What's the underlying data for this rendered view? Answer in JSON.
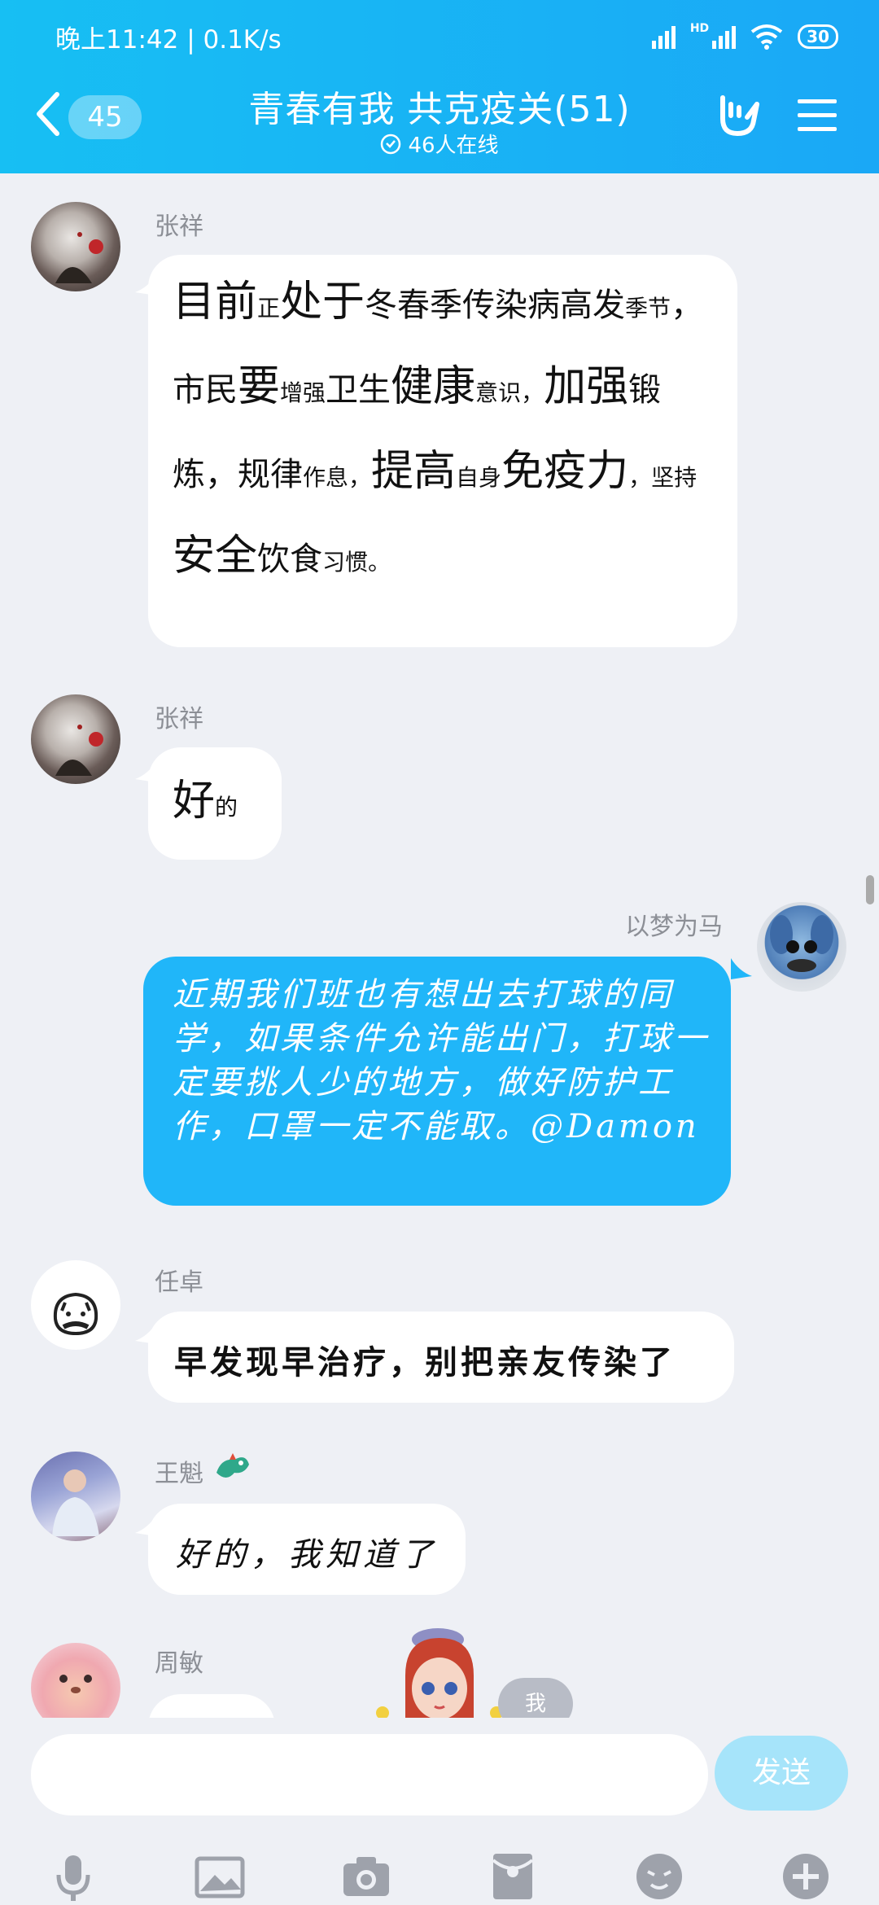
{
  "status": {
    "time_speed": "晚上11:42 | 0.1K/s",
    "network": "HD",
    "battery": "30"
  },
  "header": {
    "unread_count": "45",
    "title": "青春有我 共克疫关(51)",
    "online": "46人在线"
  },
  "messages": [
    {
      "sender": "张祥",
      "side": "left",
      "text_segments": [
        [
          "目前",
          "big"
        ],
        [
          "正",
          "sm"
        ],
        [
          "处于",
          "big"
        ],
        [
          "冬春季传染病高",
          "mid"
        ],
        [
          "发",
          "mid"
        ],
        [
          "季节",
          "sm"
        ],
        [
          "，市民",
          "mid"
        ],
        [
          "要",
          "big"
        ],
        [
          "增强",
          "sm"
        ],
        [
          "卫生",
          "mid"
        ],
        [
          "健康",
          "big"
        ],
        [
          "意",
          "sm"
        ],
        [
          "识，",
          "sm"
        ],
        [
          "加强",
          "big"
        ],
        [
          "锻炼，规律",
          "mid"
        ],
        [
          "作息，",
          "sm"
        ],
        [
          "提",
          "big"
        ],
        [
          "高",
          "big"
        ],
        [
          "自身",
          "sm"
        ],
        [
          "免疫力",
          "big"
        ],
        [
          "，坚持",
          "sm"
        ],
        [
          "安全",
          "big"
        ],
        [
          "饮",
          "mid"
        ],
        [
          "食",
          "mid"
        ],
        [
          "习惯。",
          "sm"
        ]
      ]
    },
    {
      "sender": "张祥",
      "side": "left",
      "text_segments": [
        [
          "好",
          "big"
        ],
        [
          "的",
          "sm"
        ]
      ]
    },
    {
      "sender": "以梦为马",
      "side": "right",
      "text": "近期我们班也有想出去打球的同学，如果条件允许能出门，打球一定要挑人少的地方，做好防护工作，口罩一定不能取。@Damon"
    },
    {
      "sender": "任卓",
      "side": "left",
      "text": "早发现早治疗，别把亲友传染了"
    },
    {
      "sender": "王魁",
      "side": "left",
      "text": "好的，我知道了"
    },
    {
      "sender": "周敏",
      "side": "left",
      "text": ""
    }
  ],
  "floating_label": "我",
  "input": {
    "placeholder": "",
    "send_label": "发送"
  },
  "toolbar": [
    "mic-icon",
    "image-icon",
    "camera-icon",
    "red-packet-icon",
    "emoji-icon",
    "plus-icon"
  ],
  "colors": {
    "header": "#17bff3",
    "my_bubble": "#20b6f9",
    "send_disabled": "#a6e4fa",
    "background": "#eef0f5"
  }
}
